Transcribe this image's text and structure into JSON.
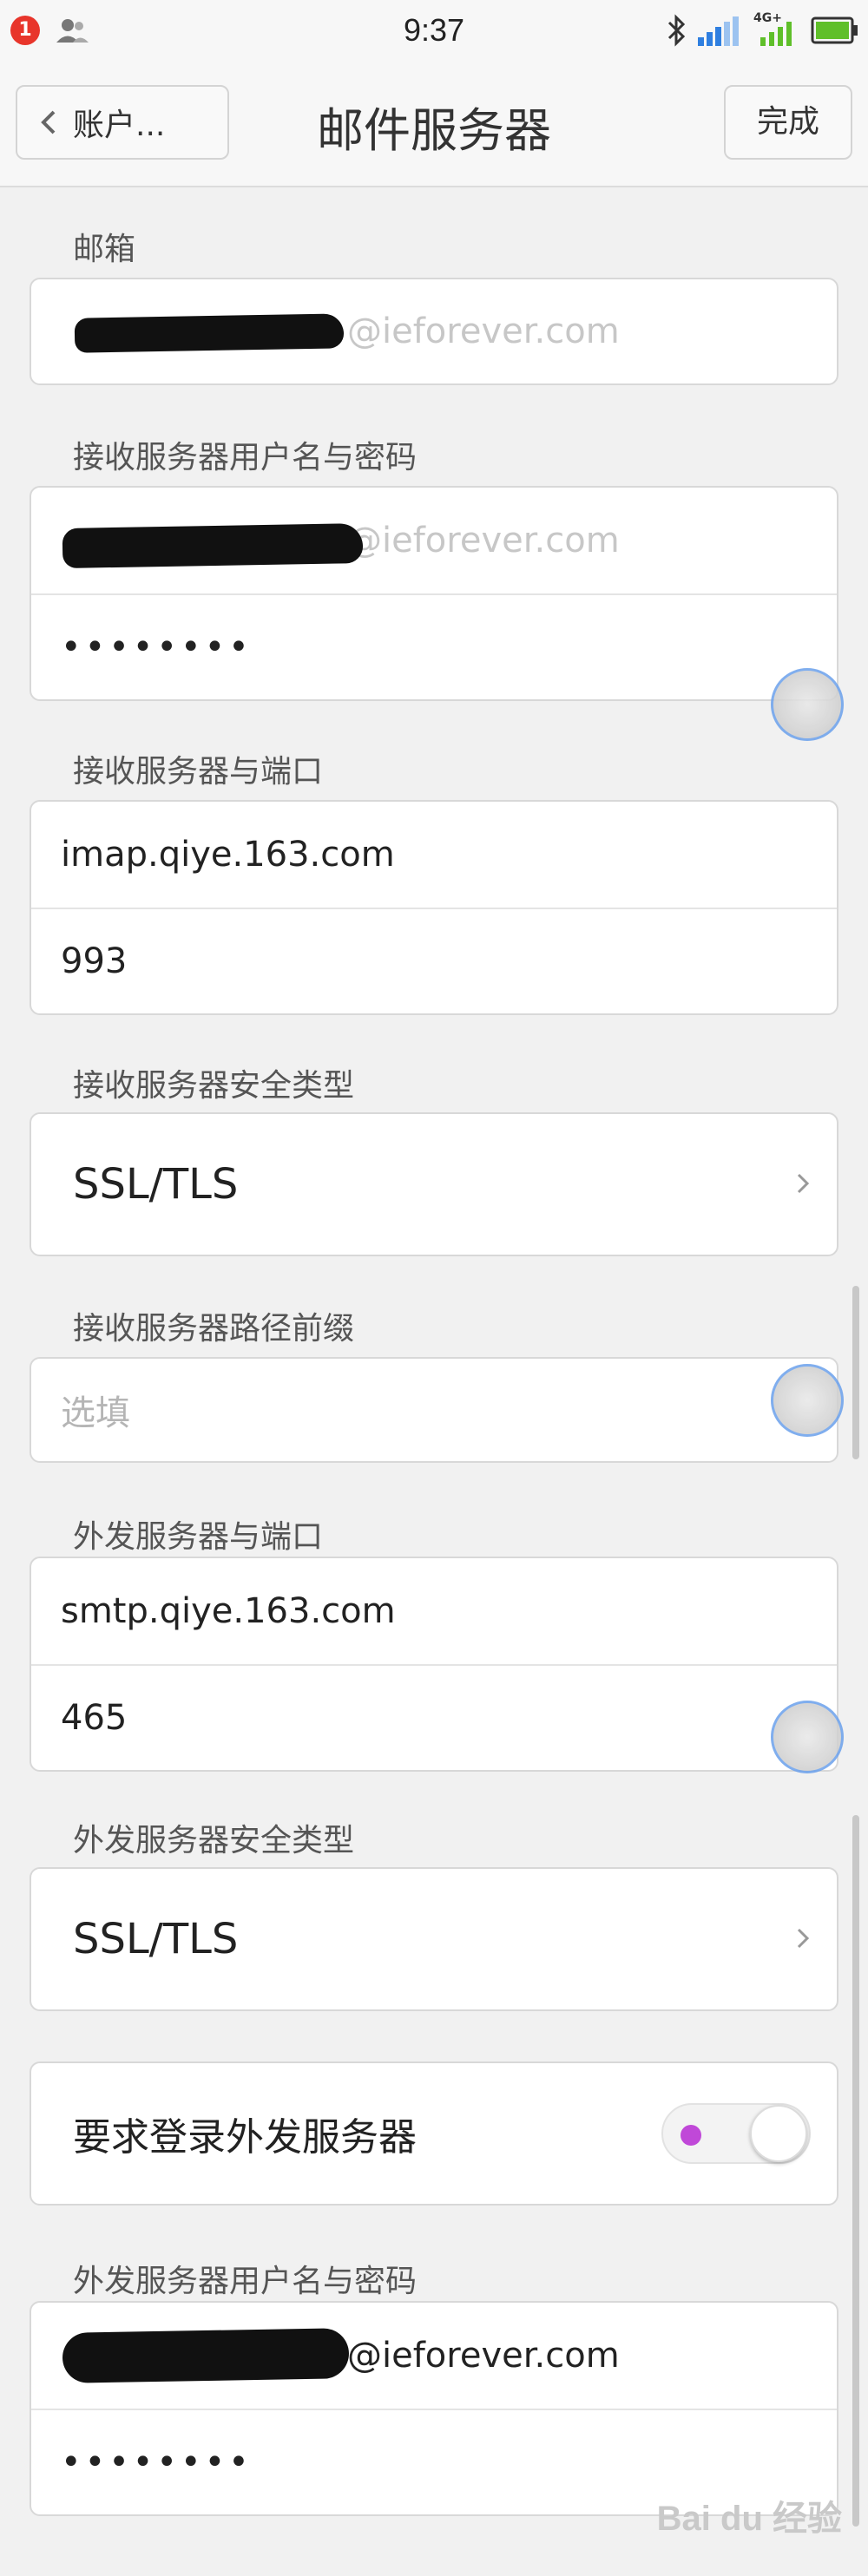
{
  "status_bar": {
    "notification_count": "1",
    "time": "9:37",
    "icons": [
      "contacts-icon",
      "bluetooth-icon",
      "signal-icon",
      "network-4g-icon",
      "battery-icon"
    ],
    "network_label": "4G+"
  },
  "nav": {
    "back_label": "账户...",
    "title": "邮件服务器",
    "done_label": "完成"
  },
  "email": {
    "label": "邮箱",
    "value_suffix": "@ieforever.com"
  },
  "incoming_credentials": {
    "label": "接收服务器用户名与密码",
    "username_suffix": "@ieforever.com",
    "password": "••••••••"
  },
  "incoming_server": {
    "label": "接收服务器与端口",
    "host": "imap.qiye.163.com",
    "port": "993"
  },
  "incoming_security": {
    "label": "接收服务器安全类型",
    "value": "SSL/TLS"
  },
  "incoming_path_prefix": {
    "label": "接收服务器路径前缀",
    "placeholder": "选填"
  },
  "outgoing_server": {
    "label": "外发服务器与端口",
    "host": "smtp.qiye.163.com",
    "port": "465"
  },
  "outgoing_security": {
    "label": "外发服务器安全类型",
    "value": "SSL/TLS"
  },
  "require_login": {
    "label": "要求登录外发服务器",
    "enabled": true
  },
  "outgoing_credentials": {
    "label": "外发服务器用户名与密码",
    "username_suffix": "@ieforever.com",
    "password": "••••••••"
  },
  "watermark": "Bai du 经验",
  "colors": {
    "background": "#f1f1f1",
    "card": "#ffffff",
    "notification": "#e8352b",
    "signal_blue": "#2f7fe0",
    "battery_green": "#5fbf2a",
    "toggle_led": "#c048d8"
  }
}
